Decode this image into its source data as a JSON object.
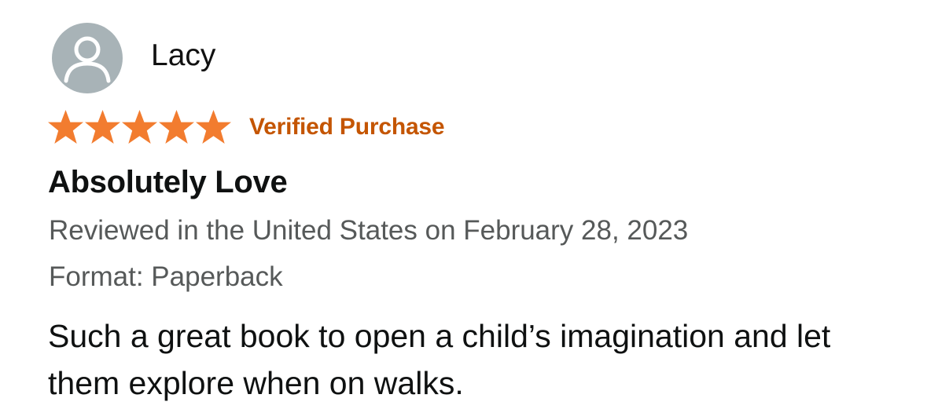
{
  "reviewer": {
    "name": "Lacy",
    "avatar_icon": "user-silhouette-icon",
    "avatar_color": "#a8b3b7"
  },
  "rating": {
    "stars": 5,
    "out_of": 5,
    "star_color": "#f27c2f",
    "star_icon": "star-icon"
  },
  "badge": {
    "label": "Verified Purchase",
    "color": "#c45500"
  },
  "review": {
    "title": "Absolutely Love",
    "date_line": "Reviewed in the United States on February 28, 2023",
    "format_line": "Format: Paperback",
    "body": "Such a great book to open a child’s imagination and let them explore when on walks."
  }
}
